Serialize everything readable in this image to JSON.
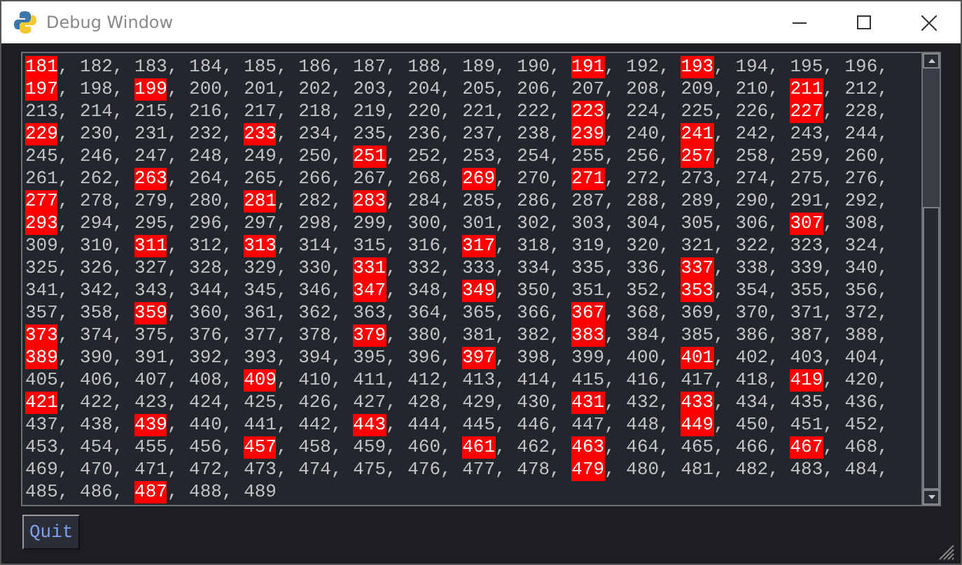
{
  "window": {
    "title": "Debug Window"
  },
  "output_rows": [
    {
      "numbers": [
        {
          "text": "181",
          "highlighted": true,
          "sep": ","
        },
        {
          "text": "182",
          "highlighted": false,
          "sep": ","
        },
        {
          "text": "183",
          "highlighted": false,
          "sep": ","
        },
        {
          "text": "184",
          "highlighted": false,
          "sep": ","
        },
        {
          "text": "185",
          "highlighted": false,
          "sep": ","
        },
        {
          "text": "186",
          "highlighted": false,
          "sep": ","
        },
        {
          "text": "187",
          "highlighted": false,
          "sep": ","
        },
        {
          "text": "188",
          "highlighted": false,
          "sep": ","
        },
        {
          "text": "189",
          "highlighted": false,
          "sep": ","
        },
        {
          "text": "190",
          "highlighted": false,
          "sep": ","
        },
        {
          "text": "191",
          "highlighted": true,
          "sep": ","
        },
        {
          "text": "192",
          "highlighted": false,
          "sep": ","
        },
        {
          "text": "193",
          "highlighted": true,
          "sep": ","
        },
        {
          "text": "194",
          "highlighted": false,
          "sep": ","
        },
        {
          "text": "195",
          "highlighted": false,
          "sep": ","
        },
        {
          "text": "196",
          "highlighted": false,
          "sep": ","
        }
      ]
    },
    {
      "numbers": [
        {
          "text": "197",
          "highlighted": true,
          "sep": ","
        },
        {
          "text": "198",
          "highlighted": false,
          "sep": ","
        },
        {
          "text": "199",
          "highlighted": true,
          "sep": ","
        },
        {
          "text": "200",
          "highlighted": false,
          "sep": ","
        },
        {
          "text": "201",
          "highlighted": false,
          "sep": ","
        },
        {
          "text": "202",
          "highlighted": false,
          "sep": ","
        },
        {
          "text": "203",
          "highlighted": false,
          "sep": ","
        },
        {
          "text": "204",
          "highlighted": false,
          "sep": ","
        },
        {
          "text": "205",
          "highlighted": false,
          "sep": ","
        },
        {
          "text": "206",
          "highlighted": false,
          "sep": ","
        },
        {
          "text": "207",
          "highlighted": false,
          "sep": ","
        },
        {
          "text": "208",
          "highlighted": false,
          "sep": ","
        },
        {
          "text": "209",
          "highlighted": false,
          "sep": ","
        },
        {
          "text": "210",
          "highlighted": false,
          "sep": ","
        },
        {
          "text": "211",
          "highlighted": true,
          "sep": ","
        },
        {
          "text": "212",
          "highlighted": false,
          "sep": ","
        }
      ]
    },
    {
      "numbers": [
        {
          "text": "213",
          "highlighted": false,
          "sep": ","
        },
        {
          "text": "214",
          "highlighted": false,
          "sep": ","
        },
        {
          "text": "215",
          "highlighted": false,
          "sep": ","
        },
        {
          "text": "216",
          "highlighted": false,
          "sep": ","
        },
        {
          "text": "217",
          "highlighted": false,
          "sep": ","
        },
        {
          "text": "218",
          "highlighted": false,
          "sep": ","
        },
        {
          "text": "219",
          "highlighted": false,
          "sep": ","
        },
        {
          "text": "220",
          "highlighted": false,
          "sep": ","
        },
        {
          "text": "221",
          "highlighted": false,
          "sep": ","
        },
        {
          "text": "222",
          "highlighted": false,
          "sep": ","
        },
        {
          "text": "223",
          "highlighted": true,
          "sep": ","
        },
        {
          "text": "224",
          "highlighted": false,
          "sep": ","
        },
        {
          "text": "225",
          "highlighted": false,
          "sep": ","
        },
        {
          "text": "226",
          "highlighted": false,
          "sep": ","
        },
        {
          "text": "227",
          "highlighted": true,
          "sep": ","
        },
        {
          "text": "228",
          "highlighted": false,
          "sep": ","
        }
      ]
    },
    {
      "numbers": [
        {
          "text": "229",
          "highlighted": true,
          "sep": ","
        },
        {
          "text": "230",
          "highlighted": false,
          "sep": ","
        },
        {
          "text": "231",
          "highlighted": false,
          "sep": ","
        },
        {
          "text": "232",
          "highlighted": false,
          "sep": ","
        },
        {
          "text": "233",
          "highlighted": true,
          "sep": ","
        },
        {
          "text": "234",
          "highlighted": false,
          "sep": ","
        },
        {
          "text": "235",
          "highlighted": false,
          "sep": ","
        },
        {
          "text": "236",
          "highlighted": false,
          "sep": ","
        },
        {
          "text": "237",
          "highlighted": false,
          "sep": ","
        },
        {
          "text": "238",
          "highlighted": false,
          "sep": ","
        },
        {
          "text": "239",
          "highlighted": true,
          "sep": ","
        },
        {
          "text": "240",
          "highlighted": false,
          "sep": ","
        },
        {
          "text": "241",
          "highlighted": true,
          "sep": ","
        },
        {
          "text": "242",
          "highlighted": false,
          "sep": ","
        },
        {
          "text": "243",
          "highlighted": false,
          "sep": ","
        },
        {
          "text": "244",
          "highlighted": false,
          "sep": ","
        }
      ]
    },
    {
      "numbers": [
        {
          "text": "245",
          "highlighted": false,
          "sep": ","
        },
        {
          "text": "246",
          "highlighted": false,
          "sep": ","
        },
        {
          "text": "247",
          "highlighted": false,
          "sep": ","
        },
        {
          "text": "248",
          "highlighted": false,
          "sep": ","
        },
        {
          "text": "249",
          "highlighted": false,
          "sep": ","
        },
        {
          "text": "250",
          "highlighted": false,
          "sep": ","
        },
        {
          "text": "251",
          "highlighted": true,
          "sep": ","
        },
        {
          "text": "252",
          "highlighted": false,
          "sep": ","
        },
        {
          "text": "253",
          "highlighted": false,
          "sep": ","
        },
        {
          "text": "254",
          "highlighted": false,
          "sep": ","
        },
        {
          "text": "255",
          "highlighted": false,
          "sep": ","
        },
        {
          "text": "256",
          "highlighted": false,
          "sep": ","
        },
        {
          "text": "257",
          "highlighted": true,
          "sep": ","
        },
        {
          "text": "258",
          "highlighted": false,
          "sep": ","
        },
        {
          "text": "259",
          "highlighted": false,
          "sep": ","
        },
        {
          "text": "260",
          "highlighted": false,
          "sep": ","
        }
      ]
    },
    {
      "numbers": [
        {
          "text": "261",
          "highlighted": false,
          "sep": ","
        },
        {
          "text": "262",
          "highlighted": false,
          "sep": ","
        },
        {
          "text": "263",
          "highlighted": true,
          "sep": ","
        },
        {
          "text": "264",
          "highlighted": false,
          "sep": ","
        },
        {
          "text": "265",
          "highlighted": false,
          "sep": ","
        },
        {
          "text": "266",
          "highlighted": false,
          "sep": ","
        },
        {
          "text": "267",
          "highlighted": false,
          "sep": ","
        },
        {
          "text": "268",
          "highlighted": false,
          "sep": ","
        },
        {
          "text": "269",
          "highlighted": true,
          "sep": ","
        },
        {
          "text": "270",
          "highlighted": false,
          "sep": ","
        },
        {
          "text": "271",
          "highlighted": true,
          "sep": ","
        },
        {
          "text": "272",
          "highlighted": false,
          "sep": ","
        },
        {
          "text": "273",
          "highlighted": false,
          "sep": ","
        },
        {
          "text": "274",
          "highlighted": false,
          "sep": ","
        },
        {
          "text": "275",
          "highlighted": false,
          "sep": ","
        },
        {
          "text": "276",
          "highlighted": false,
          "sep": ","
        }
      ]
    },
    {
      "numbers": [
        {
          "text": "277",
          "highlighted": true,
          "sep": ","
        },
        {
          "text": "278",
          "highlighted": false,
          "sep": ","
        },
        {
          "text": "279",
          "highlighted": false,
          "sep": ","
        },
        {
          "text": "280",
          "highlighted": false,
          "sep": ","
        },
        {
          "text": "281",
          "highlighted": true,
          "sep": ","
        },
        {
          "text": "282",
          "highlighted": false,
          "sep": ","
        },
        {
          "text": "283",
          "highlighted": true,
          "sep": ","
        },
        {
          "text": "284",
          "highlighted": false,
          "sep": ","
        },
        {
          "text": "285",
          "highlighted": false,
          "sep": ","
        },
        {
          "text": "286",
          "highlighted": false,
          "sep": ","
        },
        {
          "text": "287",
          "highlighted": false,
          "sep": ","
        },
        {
          "text": "288",
          "highlighted": false,
          "sep": ","
        },
        {
          "text": "289",
          "highlighted": false,
          "sep": ","
        },
        {
          "text": "290",
          "highlighted": false,
          "sep": ","
        },
        {
          "text": "291",
          "highlighted": false,
          "sep": ","
        },
        {
          "text": "292",
          "highlighted": false,
          "sep": ","
        }
      ]
    },
    {
      "numbers": [
        {
          "text": "293",
          "highlighted": true,
          "sep": ","
        },
        {
          "text": "294",
          "highlighted": false,
          "sep": ","
        },
        {
          "text": "295",
          "highlighted": false,
          "sep": ","
        },
        {
          "text": "296",
          "highlighted": false,
          "sep": ","
        },
        {
          "text": "297",
          "highlighted": false,
          "sep": ","
        },
        {
          "text": "298",
          "highlighted": false,
          "sep": ","
        },
        {
          "text": "299",
          "highlighted": false,
          "sep": ","
        },
        {
          "text": "300",
          "highlighted": false,
          "sep": ","
        },
        {
          "text": "301",
          "highlighted": false,
          "sep": ","
        },
        {
          "text": "302",
          "highlighted": false,
          "sep": ","
        },
        {
          "text": "303",
          "highlighted": false,
          "sep": ","
        },
        {
          "text": "304",
          "highlighted": false,
          "sep": ","
        },
        {
          "text": "305",
          "highlighted": false,
          "sep": ","
        },
        {
          "text": "306",
          "highlighted": false,
          "sep": ","
        },
        {
          "text": "307",
          "highlighted": true,
          "sep": ","
        },
        {
          "text": "308",
          "highlighted": false,
          "sep": ","
        }
      ]
    },
    {
      "numbers": [
        {
          "text": "309",
          "highlighted": false,
          "sep": ","
        },
        {
          "text": "310",
          "highlighted": false,
          "sep": ","
        },
        {
          "text": "311",
          "highlighted": true,
          "sep": ","
        },
        {
          "text": "312",
          "highlighted": false,
          "sep": ","
        },
        {
          "text": "313",
          "highlighted": true,
          "sep": ","
        },
        {
          "text": "314",
          "highlighted": false,
          "sep": ","
        },
        {
          "text": "315",
          "highlighted": false,
          "sep": ","
        },
        {
          "text": "316",
          "highlighted": false,
          "sep": ","
        },
        {
          "text": "317",
          "highlighted": true,
          "sep": ","
        },
        {
          "text": "318",
          "highlighted": false,
          "sep": ","
        },
        {
          "text": "319",
          "highlighted": false,
          "sep": ","
        },
        {
          "text": "320",
          "highlighted": false,
          "sep": ","
        },
        {
          "text": "321",
          "highlighted": false,
          "sep": ","
        },
        {
          "text": "322",
          "highlighted": false,
          "sep": ","
        },
        {
          "text": "323",
          "highlighted": false,
          "sep": ","
        },
        {
          "text": "324",
          "highlighted": false,
          "sep": ","
        }
      ]
    },
    {
      "numbers": [
        {
          "text": "325",
          "highlighted": false,
          "sep": ","
        },
        {
          "text": "326",
          "highlighted": false,
          "sep": ","
        },
        {
          "text": "327",
          "highlighted": false,
          "sep": ","
        },
        {
          "text": "328",
          "highlighted": false,
          "sep": ","
        },
        {
          "text": "329",
          "highlighted": false,
          "sep": ","
        },
        {
          "text": "330",
          "highlighted": false,
          "sep": ","
        },
        {
          "text": "331",
          "highlighted": true,
          "sep": ","
        },
        {
          "text": "332",
          "highlighted": false,
          "sep": ","
        },
        {
          "text": "333",
          "highlighted": false,
          "sep": ","
        },
        {
          "text": "334",
          "highlighted": false,
          "sep": ","
        },
        {
          "text": "335",
          "highlighted": false,
          "sep": ","
        },
        {
          "text": "336",
          "highlighted": false,
          "sep": ","
        },
        {
          "text": "337",
          "highlighted": true,
          "sep": ","
        },
        {
          "text": "338",
          "highlighted": false,
          "sep": ","
        },
        {
          "text": "339",
          "highlighted": false,
          "sep": ","
        },
        {
          "text": "340",
          "highlighted": false,
          "sep": ","
        }
      ]
    },
    {
      "numbers": [
        {
          "text": "341",
          "highlighted": false,
          "sep": ","
        },
        {
          "text": "342",
          "highlighted": false,
          "sep": ","
        },
        {
          "text": "343",
          "highlighted": false,
          "sep": ","
        },
        {
          "text": "344",
          "highlighted": false,
          "sep": ","
        },
        {
          "text": "345",
          "highlighted": false,
          "sep": ","
        },
        {
          "text": "346",
          "highlighted": false,
          "sep": ","
        },
        {
          "text": "347",
          "highlighted": true,
          "sep": ","
        },
        {
          "text": "348",
          "highlighted": false,
          "sep": ","
        },
        {
          "text": "349",
          "highlighted": true,
          "sep": ","
        },
        {
          "text": "350",
          "highlighted": false,
          "sep": ","
        },
        {
          "text": "351",
          "highlighted": false,
          "sep": ","
        },
        {
          "text": "352",
          "highlighted": false,
          "sep": ","
        },
        {
          "text": "353",
          "highlighted": true,
          "sep": ","
        },
        {
          "text": "354",
          "highlighted": false,
          "sep": ","
        },
        {
          "text": "355",
          "highlighted": false,
          "sep": ","
        },
        {
          "text": "356",
          "highlighted": false,
          "sep": ","
        }
      ]
    },
    {
      "numbers": [
        {
          "text": "357",
          "highlighted": false,
          "sep": ","
        },
        {
          "text": "358",
          "highlighted": false,
          "sep": ","
        },
        {
          "text": "359",
          "highlighted": true,
          "sep": ","
        },
        {
          "text": "360",
          "highlighted": false,
          "sep": ","
        },
        {
          "text": "361",
          "highlighted": false,
          "sep": ","
        },
        {
          "text": "362",
          "highlighted": false,
          "sep": ","
        },
        {
          "text": "363",
          "highlighted": false,
          "sep": ","
        },
        {
          "text": "364",
          "highlighted": false,
          "sep": ","
        },
        {
          "text": "365",
          "highlighted": false,
          "sep": ","
        },
        {
          "text": "366",
          "highlighted": false,
          "sep": ","
        },
        {
          "text": "367",
          "highlighted": true,
          "sep": ","
        },
        {
          "text": "368",
          "highlighted": false,
          "sep": ","
        },
        {
          "text": "369",
          "highlighted": false,
          "sep": ","
        },
        {
          "text": "370",
          "highlighted": false,
          "sep": ","
        },
        {
          "text": "371",
          "highlighted": false,
          "sep": ","
        },
        {
          "text": "372",
          "highlighted": false,
          "sep": ","
        }
      ]
    },
    {
      "numbers": [
        {
          "text": "373",
          "highlighted": true,
          "sep": ","
        },
        {
          "text": "374",
          "highlighted": false,
          "sep": ","
        },
        {
          "text": "375",
          "highlighted": false,
          "sep": ","
        },
        {
          "text": "376",
          "highlighted": false,
          "sep": ","
        },
        {
          "text": "377",
          "highlighted": false,
          "sep": ","
        },
        {
          "text": "378",
          "highlighted": false,
          "sep": ","
        },
        {
          "text": "379",
          "highlighted": true,
          "sep": ","
        },
        {
          "text": "380",
          "highlighted": false,
          "sep": ","
        },
        {
          "text": "381",
          "highlighted": false,
          "sep": ","
        },
        {
          "text": "382",
          "highlighted": false,
          "sep": ","
        },
        {
          "text": "383",
          "highlighted": true,
          "sep": ","
        },
        {
          "text": "384",
          "highlighted": false,
          "sep": ","
        },
        {
          "text": "385",
          "highlighted": false,
          "sep": ","
        },
        {
          "text": "386",
          "highlighted": false,
          "sep": ","
        },
        {
          "text": "387",
          "highlighted": false,
          "sep": ","
        },
        {
          "text": "388",
          "highlighted": false,
          "sep": ","
        }
      ]
    },
    {
      "numbers": [
        {
          "text": "389",
          "highlighted": true,
          "sep": ","
        },
        {
          "text": "390",
          "highlighted": false,
          "sep": ","
        },
        {
          "text": "391",
          "highlighted": false,
          "sep": ","
        },
        {
          "text": "392",
          "highlighted": false,
          "sep": ","
        },
        {
          "text": "393",
          "highlighted": false,
          "sep": ","
        },
        {
          "text": "394",
          "highlighted": false,
          "sep": ","
        },
        {
          "text": "395",
          "highlighted": false,
          "sep": ","
        },
        {
          "text": "396",
          "highlighted": false,
          "sep": ","
        },
        {
          "text": "397",
          "highlighted": true,
          "sep": ","
        },
        {
          "text": "398",
          "highlighted": false,
          "sep": ","
        },
        {
          "text": "399",
          "highlighted": false,
          "sep": ","
        },
        {
          "text": "400",
          "highlighted": false,
          "sep": ","
        },
        {
          "text": "401",
          "highlighted": true,
          "sep": ","
        },
        {
          "text": "402",
          "highlighted": false,
          "sep": ","
        },
        {
          "text": "403",
          "highlighted": false,
          "sep": ","
        },
        {
          "text": "404",
          "highlighted": false,
          "sep": ","
        }
      ]
    },
    {
      "numbers": [
        {
          "text": "405",
          "highlighted": false,
          "sep": ","
        },
        {
          "text": "406",
          "highlighted": false,
          "sep": ","
        },
        {
          "text": "407",
          "highlighted": false,
          "sep": ","
        },
        {
          "text": "408",
          "highlighted": false,
          "sep": ","
        },
        {
          "text": "409",
          "highlighted": true,
          "sep": ","
        },
        {
          "text": "410",
          "highlighted": false,
          "sep": ","
        },
        {
          "text": "411",
          "highlighted": false,
          "sep": ","
        },
        {
          "text": "412",
          "highlighted": false,
          "sep": ","
        },
        {
          "text": "413",
          "highlighted": false,
          "sep": ","
        },
        {
          "text": "414",
          "highlighted": false,
          "sep": ","
        },
        {
          "text": "415",
          "highlighted": false,
          "sep": ","
        },
        {
          "text": "416",
          "highlighted": false,
          "sep": ","
        },
        {
          "text": "417",
          "highlighted": false,
          "sep": ","
        },
        {
          "text": "418",
          "highlighted": false,
          "sep": ","
        },
        {
          "text": "419",
          "highlighted": true,
          "sep": ","
        },
        {
          "text": "420",
          "highlighted": false,
          "sep": ","
        }
      ]
    },
    {
      "numbers": [
        {
          "text": "421",
          "highlighted": true,
          "sep": ","
        },
        {
          "text": "422",
          "highlighted": false,
          "sep": ","
        },
        {
          "text": "423",
          "highlighted": false,
          "sep": ","
        },
        {
          "text": "424",
          "highlighted": false,
          "sep": ","
        },
        {
          "text": "425",
          "highlighted": false,
          "sep": ","
        },
        {
          "text": "426",
          "highlighted": false,
          "sep": ","
        },
        {
          "text": "427",
          "highlighted": false,
          "sep": ","
        },
        {
          "text": "428",
          "highlighted": false,
          "sep": ","
        },
        {
          "text": "429",
          "highlighted": false,
          "sep": ","
        },
        {
          "text": "430",
          "highlighted": false,
          "sep": ","
        },
        {
          "text": "431",
          "highlighted": true,
          "sep": ","
        },
        {
          "text": "432",
          "highlighted": false,
          "sep": ","
        },
        {
          "text": "433",
          "highlighted": true,
          "sep": ","
        },
        {
          "text": "434",
          "highlighted": false,
          "sep": ","
        },
        {
          "text": "435",
          "highlighted": false,
          "sep": ","
        },
        {
          "text": "436",
          "highlighted": false,
          "sep": ","
        }
      ]
    },
    {
      "numbers": [
        {
          "text": "437",
          "highlighted": false,
          "sep": ","
        },
        {
          "text": "438",
          "highlighted": false,
          "sep": ","
        },
        {
          "text": "439",
          "highlighted": true,
          "sep": ","
        },
        {
          "text": "440",
          "highlighted": false,
          "sep": ","
        },
        {
          "text": "441",
          "highlighted": false,
          "sep": ","
        },
        {
          "text": "442",
          "highlighted": false,
          "sep": ","
        },
        {
          "text": "443",
          "highlighted": true,
          "sep": ","
        },
        {
          "text": "444",
          "highlighted": false,
          "sep": ","
        },
        {
          "text": "445",
          "highlighted": false,
          "sep": ","
        },
        {
          "text": "446",
          "highlighted": false,
          "sep": ","
        },
        {
          "text": "447",
          "highlighted": false,
          "sep": ","
        },
        {
          "text": "448",
          "highlighted": false,
          "sep": ","
        },
        {
          "text": "449",
          "highlighted": true,
          "sep": ","
        },
        {
          "text": "450",
          "highlighted": false,
          "sep": ","
        },
        {
          "text": "451",
          "highlighted": false,
          "sep": ","
        },
        {
          "text": "452",
          "highlighted": false,
          "sep": ","
        }
      ]
    },
    {
      "numbers": [
        {
          "text": "453",
          "highlighted": false,
          "sep": ","
        },
        {
          "text": "454",
          "highlighted": false,
          "sep": ","
        },
        {
          "text": "455",
          "highlighted": false,
          "sep": ","
        },
        {
          "text": "456",
          "highlighted": false,
          "sep": ","
        },
        {
          "text": "457",
          "highlighted": true,
          "sep": ","
        },
        {
          "text": "458",
          "highlighted": false,
          "sep": ","
        },
        {
          "text": "459",
          "highlighted": false,
          "sep": ","
        },
        {
          "text": "460",
          "highlighted": false,
          "sep": ","
        },
        {
          "text": "461",
          "highlighted": true,
          "sep": ","
        },
        {
          "text": "462",
          "highlighted": false,
          "sep": ","
        },
        {
          "text": "463",
          "highlighted": true,
          "sep": ","
        },
        {
          "text": "464",
          "highlighted": false,
          "sep": ","
        },
        {
          "text": "465",
          "highlighted": false,
          "sep": ","
        },
        {
          "text": "466",
          "highlighted": false,
          "sep": ","
        },
        {
          "text": "467",
          "highlighted": true,
          "sep": ","
        },
        {
          "text": "468",
          "highlighted": false,
          "sep": ","
        }
      ]
    },
    {
      "numbers": [
        {
          "text": "469",
          "highlighted": false,
          "sep": ","
        },
        {
          "text": "470",
          "highlighted": false,
          "sep": ","
        },
        {
          "text": "471",
          "highlighted": false,
          "sep": ","
        },
        {
          "text": "472",
          "highlighted": false,
          "sep": ","
        },
        {
          "text": "473",
          "highlighted": false,
          "sep": ","
        },
        {
          "text": "474",
          "highlighted": false,
          "sep": ","
        },
        {
          "text": "475",
          "highlighted": false,
          "sep": ","
        },
        {
          "text": "476",
          "highlighted": false,
          "sep": ","
        },
        {
          "text": "477",
          "highlighted": false,
          "sep": ","
        },
        {
          "text": "478",
          "highlighted": false,
          "sep": ","
        },
        {
          "text": "479",
          "highlighted": true,
          "sep": ","
        },
        {
          "text": "480",
          "highlighted": false,
          "sep": ","
        },
        {
          "text": "481",
          "highlighted": false,
          "sep": ","
        },
        {
          "text": "482",
          "highlighted": false,
          "sep": ","
        },
        {
          "text": "483",
          "highlighted": false,
          "sep": ","
        },
        {
          "text": "484",
          "highlighted": false,
          "sep": ","
        }
      ]
    },
    {
      "numbers": [
        {
          "text": "485",
          "highlighted": false,
          "sep": ","
        },
        {
          "text": "486",
          "highlighted": false,
          "sep": ","
        },
        {
          "text": "487",
          "highlighted": true,
          "sep": ","
        },
        {
          "text": "488",
          "highlighted": false,
          "sep": ","
        },
        {
          "text": "489",
          "highlighted": false
        }
      ]
    }
  ],
  "buttons": [
    {
      "label": "Quit"
    }
  ]
}
